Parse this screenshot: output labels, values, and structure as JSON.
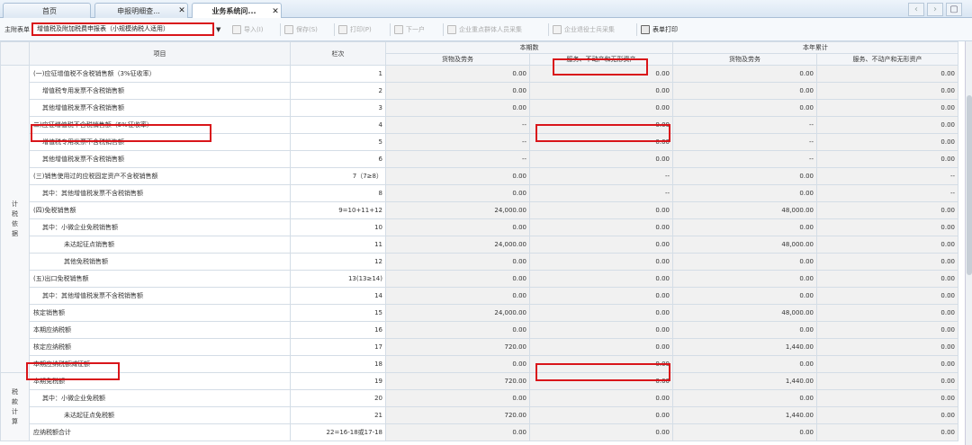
{
  "tabs": [
    {
      "label": "首页",
      "closable": false
    },
    {
      "label": "申报明细查...",
      "closable": true
    },
    {
      "label": "业务系统问...",
      "closable": true,
      "active": true
    }
  ],
  "toolbar": {
    "label": "主附表单",
    "selected_form": "增值税及附加税费申报表（小规模纳税人适用）",
    "buttons": [
      {
        "label": "导入(I)",
        "enabled": false,
        "icon": "import-icon"
      },
      {
        "label": "保存(S)",
        "enabled": false,
        "icon": "save-icon"
      },
      {
        "label": "打印(P)",
        "enabled": false,
        "icon": "print-icon"
      },
      {
        "label": "下一户",
        "enabled": false,
        "icon": "next-icon"
      },
      {
        "label": "企业重点群体人员采集",
        "enabled": false,
        "icon": "edit-icon"
      },
      {
        "label": "企业退役士兵采集",
        "enabled": false,
        "icon": "edit-icon"
      },
      {
        "label": "表单打印",
        "enabled": true,
        "icon": "print-icon"
      }
    ]
  },
  "table": {
    "header": {
      "item": "项目",
      "line": "栏次",
      "current": "本期数",
      "ytd": "本年累计",
      "goods": "货物及劳务",
      "services": "服务、不动产和无形资产"
    },
    "sections": [
      {
        "label": "计税依据",
        "rows": 18
      },
      {
        "label": "税款计算",
        "rows": 6
      }
    ],
    "rows": [
      {
        "item": "(一)应征增值税不含税销售额（3%征收率）",
        "indent": 0,
        "line": "1",
        "v": [
          "0.00",
          "0.00",
          "0.00",
          "0.00"
        ]
      },
      {
        "item": "增值税专用发票不含税销售额",
        "indent": 1,
        "line": "2",
        "v": [
          "0.00",
          "0.00",
          "0.00",
          "0.00"
        ]
      },
      {
        "item": "其他增值税发票不含税销售额",
        "indent": 1,
        "line": "3",
        "v": [
          "0.00",
          "0.00",
          "0.00",
          "0.00"
        ]
      },
      {
        "item": "二)应征增值税不含税销售额（5%征收率）",
        "indent": 0,
        "line": "4",
        "v": [
          "--",
          "0.00",
          "--",
          "0.00"
        ]
      },
      {
        "item": "增值税专用发票不含税销售额",
        "indent": 1,
        "line": "5",
        "v": [
          "--",
          "0.00",
          "--",
          "0.00"
        ]
      },
      {
        "item": "其他增值税发票不含税销售额",
        "indent": 1,
        "line": "6",
        "v": [
          "--",
          "0.00",
          "--",
          "0.00"
        ]
      },
      {
        "item": "(三)销售使用过的应税固定资产不含税销售额",
        "indent": 0,
        "line": "7（7≥8）",
        "v": [
          "0.00",
          "--",
          "0.00",
          "--"
        ]
      },
      {
        "item": "其中：其他增值税发票不含税销售额",
        "indent": 1,
        "line": "8",
        "v": [
          "0.00",
          "--",
          "0.00",
          "--"
        ]
      },
      {
        "item": "(四)免税销售额",
        "indent": 0,
        "line": "9=10+11+12",
        "v": [
          "24,000.00",
          "0.00",
          "48,000.00",
          "0.00"
        ]
      },
      {
        "item": "其中：小微企业免税销售额",
        "indent": 1,
        "line": "10",
        "v": [
          "0.00",
          "0.00",
          "0.00",
          "0.00"
        ]
      },
      {
        "item": "未达起征点销售额",
        "indent": 2,
        "line": "11",
        "v": [
          "24,000.00",
          "0.00",
          "48,000.00",
          "0.00"
        ]
      },
      {
        "item": "其他免税销售额",
        "indent": 2,
        "line": "12",
        "v": [
          "0.00",
          "0.00",
          "0.00",
          "0.00"
        ]
      },
      {
        "item": "(五)出口免税销售额",
        "indent": 0,
        "line": "13(13≥14)",
        "v": [
          "0.00",
          "0.00",
          "0.00",
          "0.00"
        ]
      },
      {
        "item": "其中：其他增值税发票不含税销售额",
        "indent": 1,
        "line": "14",
        "v": [
          "0.00",
          "0.00",
          "0.00",
          "0.00"
        ]
      },
      {
        "item": "核定销售额",
        "indent": 0,
        "line": "15",
        "v": [
          "24,000.00",
          "0.00",
          "48,000.00",
          "0.00"
        ]
      },
      {
        "item": "本期应纳税额",
        "indent": 0,
        "line": "16",
        "v": [
          "0.00",
          "0.00",
          "0.00",
          "0.00"
        ]
      },
      {
        "item": "核定应纳税额",
        "indent": 0,
        "line": "17",
        "v": [
          "720.00",
          "0.00",
          "1,440.00",
          "0.00"
        ]
      },
      {
        "item": "本期应纳税额减征额",
        "indent": 0,
        "line": "18",
        "v": [
          "0.00",
          "0.00",
          "0.00",
          "0.00"
        ]
      },
      {
        "item": "本期免税额",
        "indent": 0,
        "line": "19",
        "v": [
          "720.00",
          "0.00",
          "1,440.00",
          "0.00"
        ]
      },
      {
        "item": "其中：小微企业免税额",
        "indent": 1,
        "line": "20",
        "v": [
          "0.00",
          "0.00",
          "0.00",
          "0.00"
        ]
      },
      {
        "item": "未达起征点免税额",
        "indent": 2,
        "line": "21",
        "v": [
          "720.00",
          "0.00",
          "1,440.00",
          "0.00"
        ]
      },
      {
        "item": "应纳税额合计",
        "indent": 0,
        "line": "22=16-18或17-18",
        "v": [
          "0.00",
          "0.00",
          "0.00",
          "0.00"
        ]
      }
    ]
  }
}
